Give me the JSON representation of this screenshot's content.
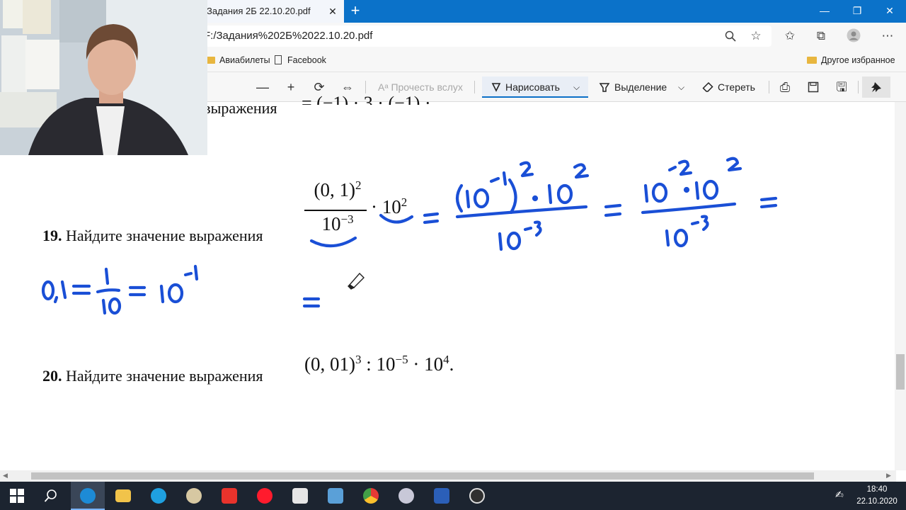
{
  "browser": {
    "tab_title": "Задания 2Б 22.10.20.pdf",
    "tab_close": "✕",
    "new_tab": "+",
    "window_controls": {
      "minimize": "—",
      "restore": "❐",
      "close": "✕"
    },
    "address": "F:/Задания%202Б%2022.10.20.pdf",
    "icons": [
      "zoom-icon",
      "star-icon",
      "favorites-icon",
      "collections-icon",
      "profile-icon",
      "more-icon"
    ]
  },
  "favorites_bar": {
    "items": [
      {
        "label": "Авиабилеты",
        "icon": "folder-icon"
      },
      {
        "label": "Facebook",
        "icon": "page-icon"
      }
    ],
    "other": "Другое избранное"
  },
  "pdf_toolbar": {
    "zoom_out": "—",
    "zoom_in": "+",
    "read_aloud": "Прочесть вслух",
    "draw": "Нарисовать",
    "highlight": "Выделение",
    "erase": "Стереть"
  },
  "document": {
    "top_partial": "е выражения",
    "task19": {
      "number": "19.",
      "text": "Найдите значение выражения"
    },
    "task20": {
      "number": "20.",
      "text": "Найдите значение выражения"
    },
    "expr19": {
      "num": "(0, 1)",
      "num_exp": "2",
      "den": "10",
      "den_exp": "−3",
      "factor": "· 10",
      "factor_exp": "2"
    },
    "expr20": {
      "base": "(0, 01)",
      "base_exp": "3",
      "div": " : 10",
      "div_exp": "−5",
      "mul": " · 10",
      "mul_exp": "4",
      "end": "."
    }
  },
  "taskbar": {
    "time": "18:40",
    "date": "22.10.2020",
    "apps": [
      "windows-start",
      "search",
      "edge",
      "file-explorer",
      "skype",
      "paint",
      "yandex",
      "opera",
      "video-editor",
      "notes",
      "chrome",
      "paint-3d",
      "word",
      "obs"
    ]
  }
}
